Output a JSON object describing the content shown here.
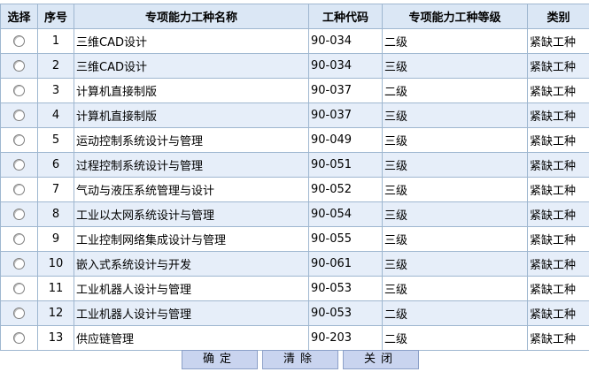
{
  "table": {
    "headers": {
      "select": "选择",
      "index": "序号",
      "name": "专项能力工种名称",
      "code": "工种代码",
      "level": "专项能力工种等级",
      "category": "类别"
    },
    "rows": [
      {
        "index": "1",
        "name": "三维CAD设计",
        "code": "90-034",
        "level": "二级",
        "category": "紧缺工种"
      },
      {
        "index": "2",
        "name": "三维CAD设计",
        "code": "90-034",
        "level": "三级",
        "category": "紧缺工种"
      },
      {
        "index": "3",
        "name": "计算机直接制版",
        "code": "90-037",
        "level": "二级",
        "category": "紧缺工种"
      },
      {
        "index": "4",
        "name": "计算机直接制版",
        "code": "90-037",
        "level": "三级",
        "category": "紧缺工种"
      },
      {
        "index": "5",
        "name": "运动控制系统设计与管理",
        "code": "90-049",
        "level": "三级",
        "category": "紧缺工种"
      },
      {
        "index": "6",
        "name": "过程控制系统设计与管理",
        "code": "90-051",
        "level": "三级",
        "category": "紧缺工种"
      },
      {
        "index": "7",
        "name": "气动与液压系统管理与设计",
        "code": "90-052",
        "level": "三级",
        "category": "紧缺工种"
      },
      {
        "index": "8",
        "name": "工业以太网系统设计与管理",
        "code": "90-054",
        "level": "三级",
        "category": "紧缺工种"
      },
      {
        "index": "9",
        "name": "工业控制网络集成设计与管理",
        "code": "90-055",
        "level": "三级",
        "category": "紧缺工种"
      },
      {
        "index": "10",
        "name": "嵌入式系统设计与开发",
        "code": "90-061",
        "level": "三级",
        "category": "紧缺工种"
      },
      {
        "index": "11",
        "name": "工业机器人设计与管理",
        "code": "90-053",
        "level": "三级",
        "category": "紧缺工种"
      },
      {
        "index": "12",
        "name": "工业机器人设计与管理",
        "code": "90-053",
        "level": "二级",
        "category": "紧缺工种"
      },
      {
        "index": "13",
        "name": "供应链管理",
        "code": "90-203",
        "level": "二级",
        "category": "紧缺工种"
      }
    ]
  },
  "buttons": {
    "confirm": "确定",
    "clear": "清除",
    "close": "关闭"
  }
}
